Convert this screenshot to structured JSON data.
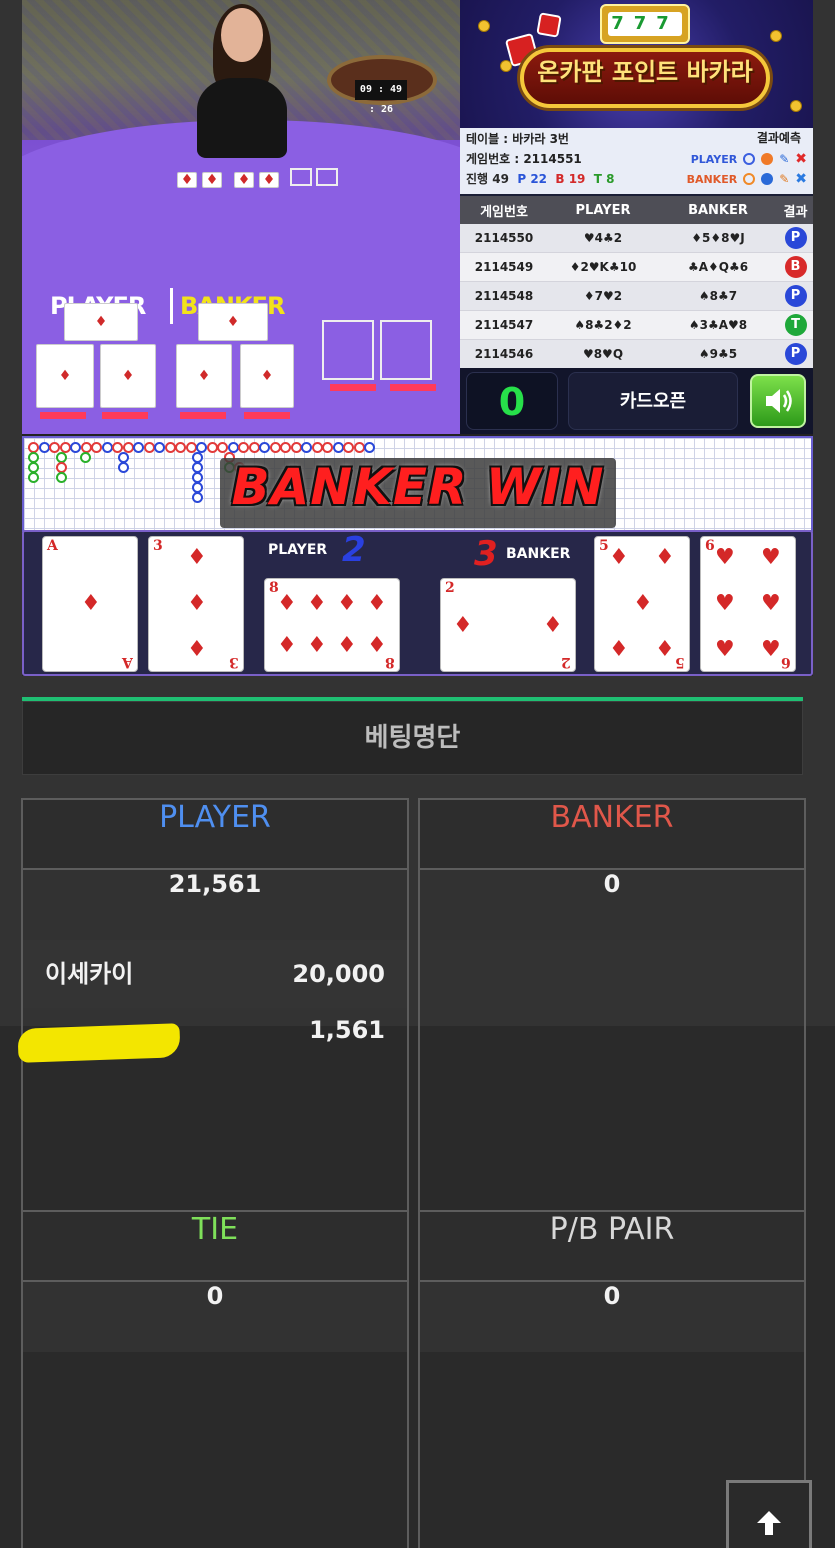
{
  "video": {
    "clock": "09 : 49 : 26",
    "player_label": "PLAYER",
    "banker_label": "BANKER"
  },
  "banner": {
    "title": "온카판 포인트 바카라",
    "sevens": "777"
  },
  "info": {
    "table": "테이블 : 바카라 3번",
    "game_no": "게임번호 : 2114551",
    "progress_label": "진행",
    "progress": "49",
    "p_count": "P 22",
    "b_count": "B 19",
    "t_count": "T 8",
    "prediction_title": "결과예측",
    "pred_player": "PLAYER",
    "pred_banker": "BANKER"
  },
  "history": {
    "headers": [
      "게임번호",
      "PLAYER",
      "BANKER",
      "결과"
    ],
    "rows": [
      {
        "no": "2114550",
        "player": "♥4♣2",
        "banker": "♦5♦8♥J",
        "result": "P",
        "color": "#2a48d8"
      },
      {
        "no": "2114549",
        "player": "♦2♥K♣10",
        "banker": "♣A♦Q♣6",
        "result": "B",
        "color": "#d82a2a"
      },
      {
        "no": "2114548",
        "player": "♦7♥2",
        "banker": "♠8♣7",
        "result": "P",
        "color": "#2a48d8"
      },
      {
        "no": "2114547",
        "player": "♠8♣2♦2",
        "banker": "♠3♣A♥8",
        "result": "T",
        "color": "#1fa83a"
      },
      {
        "no": "2114546",
        "player": "♥8♥Q",
        "banker": "♠9♣5",
        "result": "P",
        "color": "#2a48d8"
      }
    ]
  },
  "controls": {
    "count": "0",
    "open_label": "카드오픈",
    "sound_icon": "speaker-icon"
  },
  "result_banner": "BANKER WIN",
  "cards": {
    "player_label": "PLAYER",
    "player_score": "2",
    "banker_label": "BANKER",
    "banker_score": "3",
    "player_cards": [
      "A",
      "3",
      "8"
    ],
    "banker_cards": [
      "2",
      "5",
      "6"
    ]
  },
  "bet_list": {
    "title": "베팅명단",
    "player": {
      "label": "PLAYER",
      "total": "21,561",
      "rows": [
        {
          "name": "이세카이",
          "amount": "20,000"
        },
        {
          "name": "",
          "amount": "1,561"
        }
      ]
    },
    "banker": {
      "label": "BANKER",
      "total": "0"
    },
    "tie": {
      "label": "TIE",
      "total": "0"
    },
    "pair": {
      "label": "P/B PAIR",
      "total": "0"
    }
  },
  "colors": {
    "player": "#4f8ff0",
    "banker": "#e0574a",
    "tie": "#7fe05a",
    "pair": "#d8d8d8",
    "accent_green": "#1fbf73"
  },
  "top_button_icon": "arrow-up-icon"
}
